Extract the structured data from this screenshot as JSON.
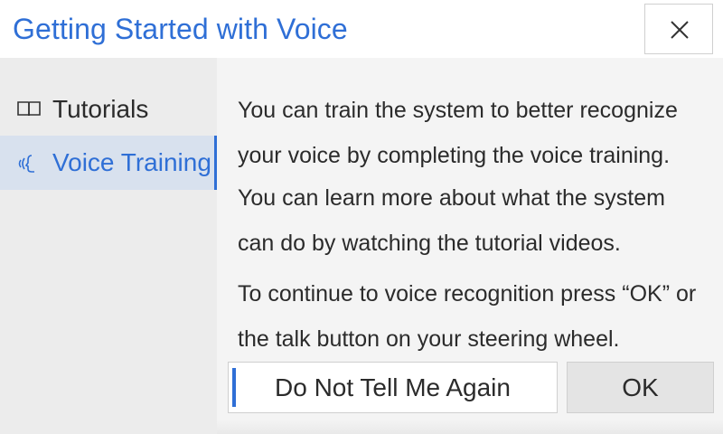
{
  "header": {
    "title": "Getting  Started with Voice",
    "close_icon": "close-icon"
  },
  "sidebar": {
    "items": [
      {
        "label": "Tutorials",
        "icon": "book-icon",
        "active": false
      },
      {
        "label": "Voice Training",
        "icon": "voice-speaking-icon",
        "active": true
      }
    ]
  },
  "content": {
    "paragraphs": [
      "You can train the system to better recognize your voice by completing the voice training.",
      "You can learn more about what the system can do by watching the tutorial videos.",
      "To continue to voice recognition press “OK” or the talk button on your steering wheel."
    ]
  },
  "buttons": {
    "dont_tell_label": "Do Not Tell Me Again",
    "ok_label": "OK"
  },
  "colors": {
    "accent": "#2f6fd6",
    "sidebar_bg": "#ececec",
    "active_item_bg": "#d8e1ee",
    "content_bg": "#f4f4f4"
  }
}
